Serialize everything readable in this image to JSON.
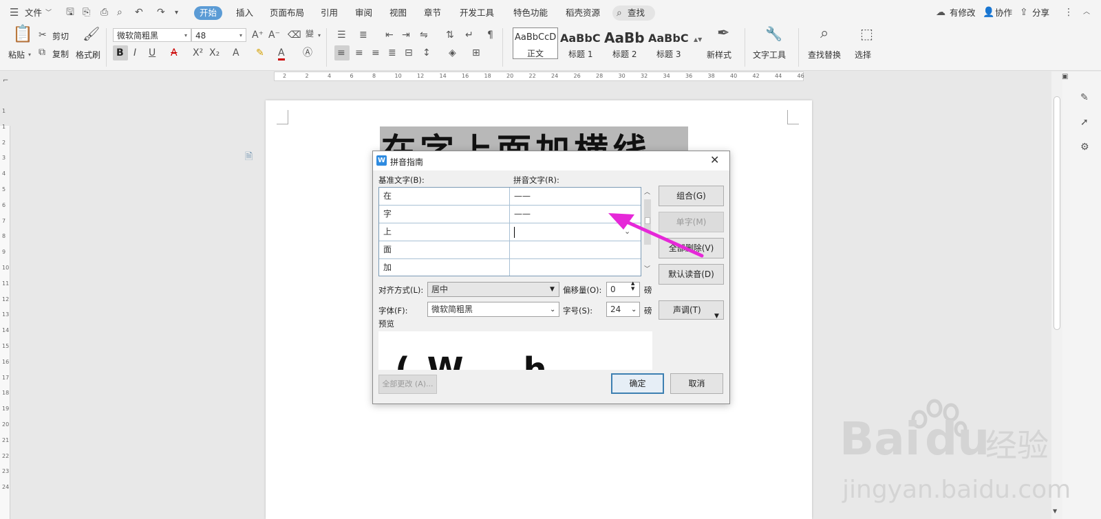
{
  "menubar": {
    "file_label": "文件",
    "tabs": [
      {
        "label": "开始",
        "active": true
      },
      {
        "label": "插入"
      },
      {
        "label": "页面布局"
      },
      {
        "label": "引用"
      },
      {
        "label": "审阅"
      },
      {
        "label": "视图"
      },
      {
        "label": "章节"
      },
      {
        "label": "开发工具"
      },
      {
        "label": "特色功能"
      },
      {
        "label": "稻壳资源"
      }
    ],
    "search_label": "查找",
    "right": {
      "modified": "有修改",
      "collab": "协作",
      "share": "分享"
    }
  },
  "ribbon": {
    "paste": "粘贴",
    "cut": "剪切",
    "copy": "复制",
    "format_painter": "格式刷",
    "font_name": "微软简粗黑",
    "font_size": "48",
    "styles": [
      {
        "preview": "AaBbCcD",
        "name": "正文"
      },
      {
        "preview": "AaBbC",
        "name": "标题 1"
      },
      {
        "preview": "AaBb",
        "name": "标题 2"
      },
      {
        "preview": "AaBbC",
        "name": "标题 3"
      }
    ],
    "new_style": "新样式",
    "text_tools": "文字工具",
    "find_replace": "查找替换",
    "select": "选择"
  },
  "ruler": {
    "h_ticks": [
      "2",
      "2",
      "4",
      "6",
      "8",
      "10",
      "12",
      "14",
      "16",
      "18",
      "20",
      "22",
      "24",
      "26",
      "28",
      "30",
      "32",
      "34",
      "36",
      "38",
      "40",
      "42",
      "44",
      "46"
    ],
    "v_ticks": [
      "1",
      "1",
      "2",
      "3",
      "4",
      "5",
      "6",
      "7",
      "8",
      "9",
      "10",
      "11",
      "12",
      "13",
      "14",
      "15",
      "16",
      "17",
      "18",
      "19",
      "20",
      "21",
      "22",
      "23",
      "24"
    ]
  },
  "document": {
    "title_text": "在字上面加横线"
  },
  "dialog": {
    "title": "拼音指南",
    "base_label": "基准文字(B):",
    "pinyin_label": "拼音文字(R):",
    "rows": [
      {
        "base": "在",
        "pinyin": "——"
      },
      {
        "base": "字",
        "pinyin": "——"
      },
      {
        "base": "上",
        "pinyin": ""
      },
      {
        "base": "面",
        "pinyin": ""
      },
      {
        "base": "加",
        "pinyin": ""
      }
    ],
    "btn_group": "组合(G)",
    "btn_single": "单字(M)",
    "btn_clear": "全部删除(V)",
    "btn_default": "默认读音(D)",
    "align_label": "对齐方式(L):",
    "align_value": "居中",
    "offset_label": "偏移量(O):",
    "offset_value": "0",
    "unit": "磅",
    "font_label": "字体(F):",
    "font_value": "微软简粗黑",
    "size_label": "字号(S):",
    "size_value": "24",
    "tone_btn": "声调(T)",
    "preview_label": "预览",
    "preview_text": "( W    h",
    "btn_change_all": "全部更改 (A)...",
    "btn_ok": "确定",
    "btn_cancel": "取消"
  },
  "watermark": {
    "brand": "Bai",
    "brand2": "du",
    "suffix": "经验",
    "url": "jingyan.baidu.com"
  },
  "colors": {
    "accent": "#5b9bd5",
    "arrow": "#e628d8",
    "highlight": "#b8b8b8"
  }
}
